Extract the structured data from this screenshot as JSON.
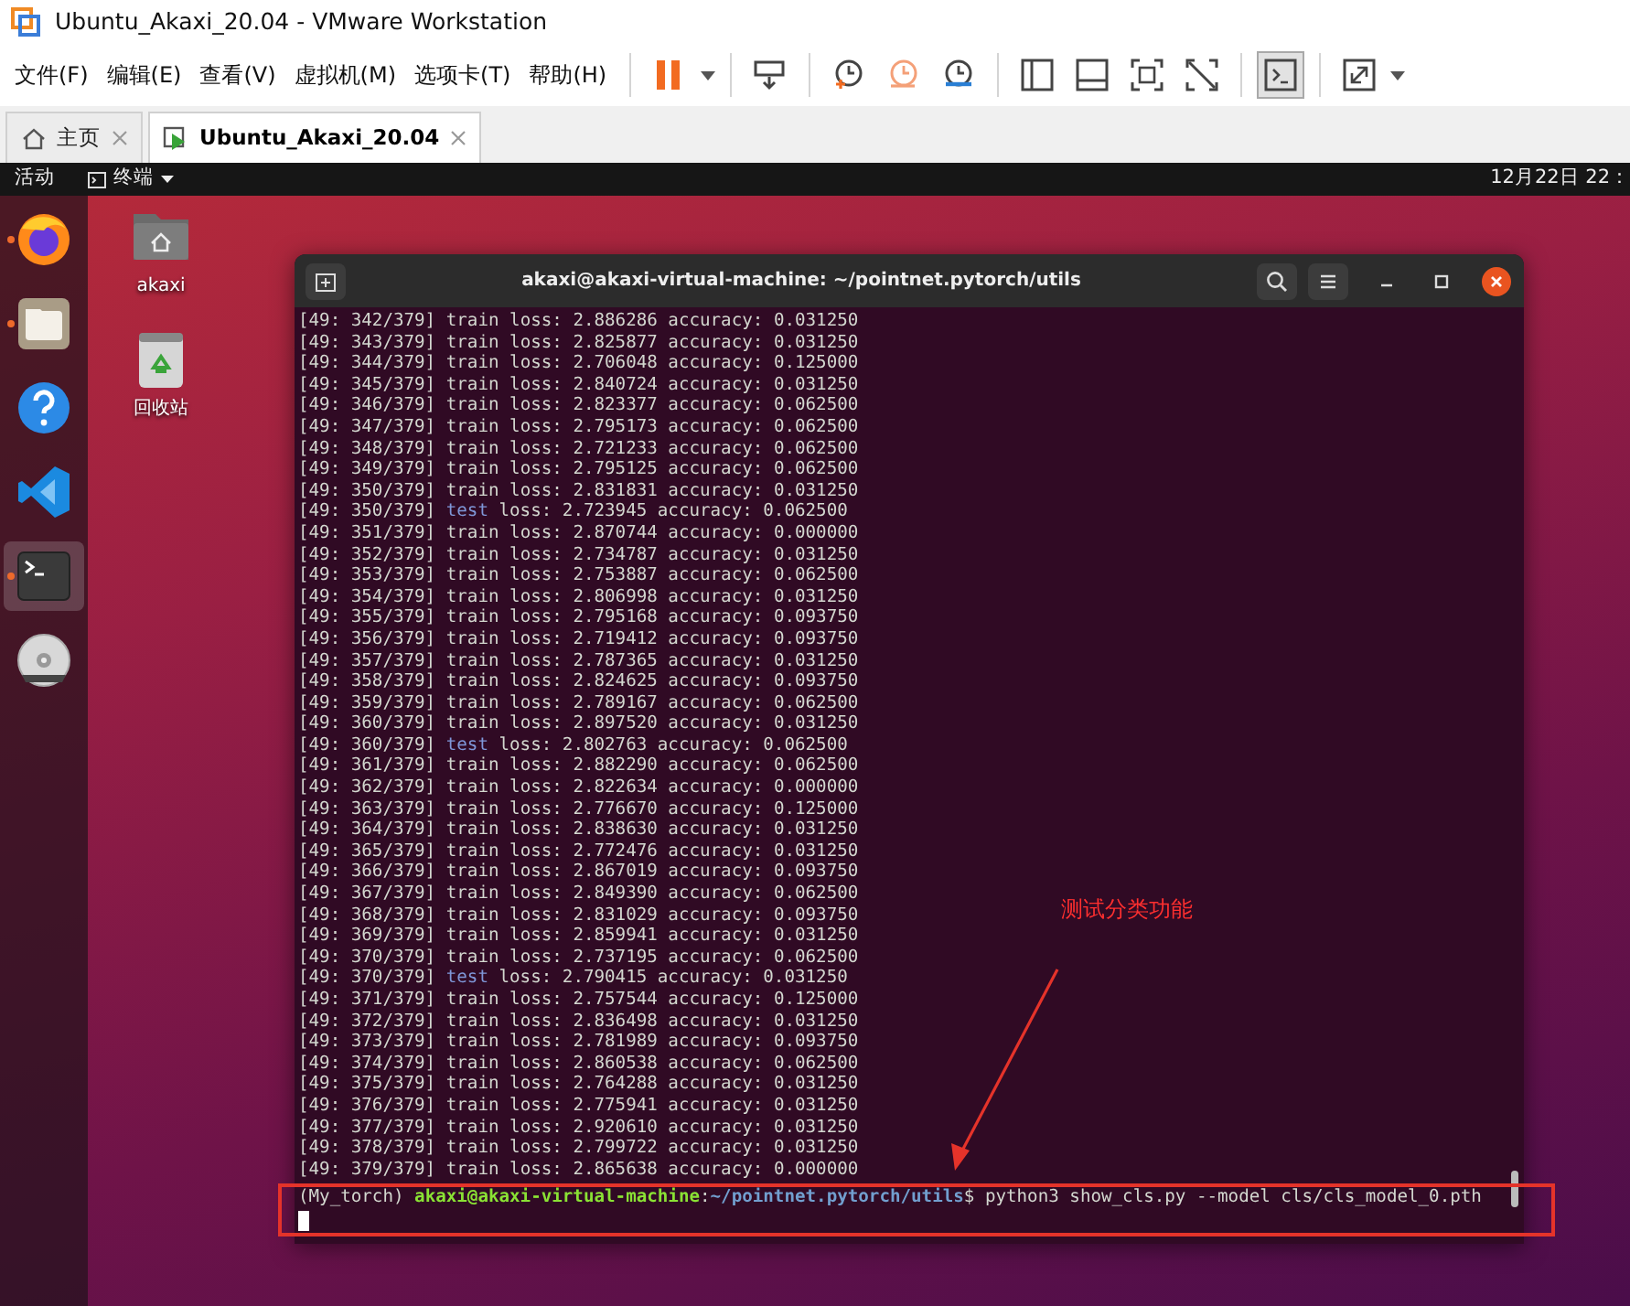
{
  "window": {
    "title": "Ubuntu_Akaxi_20.04 - VMware Workstation"
  },
  "menu": [
    "文件(F)",
    "编辑(E)",
    "查看(V)",
    "虚拟机(M)",
    "选项卡(T)",
    "帮助(H)"
  ],
  "toolbar": [
    [
      {
        "kind": "pause",
        "dropdown": true,
        "selected": false
      }
    ],
    [
      {
        "kind": "send-keys",
        "dropdown": false,
        "selected": false
      }
    ],
    [
      {
        "kind": "snapshot-take",
        "dropdown": false,
        "selected": false
      },
      {
        "kind": "snapshot-revert",
        "dropdown": false,
        "selected": false
      },
      {
        "kind": "snapshot-manager",
        "dropdown": false,
        "selected": false
      }
    ],
    [
      {
        "kind": "library",
        "dropdown": false,
        "selected": false
      },
      {
        "kind": "thumbnail",
        "dropdown": false,
        "selected": false
      },
      {
        "kind": "fullscreen",
        "dropdown": false,
        "selected": false
      },
      {
        "kind": "unity",
        "dropdown": false,
        "selected": false
      }
    ],
    [
      {
        "kind": "console",
        "dropdown": false,
        "selected": true
      }
    ],
    [
      {
        "kind": "stretch",
        "dropdown": true,
        "selected": false
      }
    ]
  ],
  "tabs": [
    {
      "kind": "home",
      "label": "主页",
      "selected": false
    },
    {
      "kind": "vm",
      "label": "Ubuntu_Akaxi_20.04",
      "selected": true
    }
  ],
  "guest_topbar": {
    "activities": "活动",
    "app_menu": "终端",
    "clock": "12月22日 22："
  },
  "dock": [
    {
      "kind": "firefox",
      "running": true,
      "selected": false
    },
    {
      "kind": "files",
      "running": true,
      "selected": false
    },
    {
      "kind": "help",
      "running": false,
      "selected": false
    },
    {
      "kind": "vscode",
      "running": false,
      "selected": false
    },
    {
      "kind": "terminal",
      "running": true,
      "selected": true
    },
    {
      "kind": "dvd",
      "running": false,
      "selected": false
    }
  ],
  "desktop_icons": [
    {
      "kind": "home-folder",
      "label": "akaxi"
    },
    {
      "kind": "trash",
      "label": "回收站"
    }
  ],
  "terminal": {
    "title": "akaxi@akaxi-virtual-machine: ~/pointnet.pytorch/utils",
    "lines": [
      {
        "kind": "train",
        "step": "[49: 342/379]",
        "label": "train",
        "rest": "loss: 2.886286 accuracy: 0.031250"
      },
      {
        "kind": "train",
        "step": "[49: 343/379]",
        "label": "train",
        "rest": "loss: 2.825877 accuracy: 0.031250"
      },
      {
        "kind": "train",
        "step": "[49: 344/379]",
        "label": "train",
        "rest": "loss: 2.706048 accuracy: 0.125000"
      },
      {
        "kind": "train",
        "step": "[49: 345/379]",
        "label": "train",
        "rest": "loss: 2.840724 accuracy: 0.031250"
      },
      {
        "kind": "train",
        "step": "[49: 346/379]",
        "label": "train",
        "rest": "loss: 2.823377 accuracy: 0.062500"
      },
      {
        "kind": "train",
        "step": "[49: 347/379]",
        "label": "train",
        "rest": "loss: 2.795173 accuracy: 0.062500"
      },
      {
        "kind": "train",
        "step": "[49: 348/379]",
        "label": "train",
        "rest": "loss: 2.721233 accuracy: 0.062500"
      },
      {
        "kind": "train",
        "step": "[49: 349/379]",
        "label": "train",
        "rest": "loss: 2.795125 accuracy: 0.062500"
      },
      {
        "kind": "train",
        "step": "[49: 350/379]",
        "label": "train",
        "rest": "loss: 2.831831 accuracy: 0.031250"
      },
      {
        "kind": "test",
        "step": "[49: 350/379]",
        "label": "test",
        "rest": "loss: 2.723945 accuracy: 0.062500"
      },
      {
        "kind": "train",
        "step": "[49: 351/379]",
        "label": "train",
        "rest": "loss: 2.870744 accuracy: 0.000000"
      },
      {
        "kind": "train",
        "step": "[49: 352/379]",
        "label": "train",
        "rest": "loss: 2.734787 accuracy: 0.031250"
      },
      {
        "kind": "train",
        "step": "[49: 353/379]",
        "label": "train",
        "rest": "loss: 2.753887 accuracy: 0.062500"
      },
      {
        "kind": "train",
        "step": "[49: 354/379]",
        "label": "train",
        "rest": "loss: 2.806998 accuracy: 0.031250"
      },
      {
        "kind": "train",
        "step": "[49: 355/379]",
        "label": "train",
        "rest": "loss: 2.795168 accuracy: 0.093750"
      },
      {
        "kind": "train",
        "step": "[49: 356/379]",
        "label": "train",
        "rest": "loss: 2.719412 accuracy: 0.093750"
      },
      {
        "kind": "train",
        "step": "[49: 357/379]",
        "label": "train",
        "rest": "loss: 2.787365 accuracy: 0.031250"
      },
      {
        "kind": "train",
        "step": "[49: 358/379]",
        "label": "train",
        "rest": "loss: 2.824625 accuracy: 0.093750"
      },
      {
        "kind": "train",
        "step": "[49: 359/379]",
        "label": "train",
        "rest": "loss: 2.789167 accuracy: 0.062500"
      },
      {
        "kind": "train",
        "step": "[49: 360/379]",
        "label": "train",
        "rest": "loss: 2.897520 accuracy: 0.031250"
      },
      {
        "kind": "test",
        "step": "[49: 360/379]",
        "label": "test",
        "rest": "loss: 2.802763 accuracy: 0.062500"
      },
      {
        "kind": "train",
        "step": "[49: 361/379]",
        "label": "train",
        "rest": "loss: 2.882290 accuracy: 0.062500"
      },
      {
        "kind": "train",
        "step": "[49: 362/379]",
        "label": "train",
        "rest": "loss: 2.822634 accuracy: 0.000000"
      },
      {
        "kind": "train",
        "step": "[49: 363/379]",
        "label": "train",
        "rest": "loss: 2.776670 accuracy: 0.125000"
      },
      {
        "kind": "train",
        "step": "[49: 364/379]",
        "label": "train",
        "rest": "loss: 2.838630 accuracy: 0.031250"
      },
      {
        "kind": "train",
        "step": "[49: 365/379]",
        "label": "train",
        "rest": "loss: 2.772476 accuracy: 0.031250"
      },
      {
        "kind": "train",
        "step": "[49: 366/379]",
        "label": "train",
        "rest": "loss: 2.867019 accuracy: 0.093750"
      },
      {
        "kind": "train",
        "step": "[49: 367/379]",
        "label": "train",
        "rest": "loss: 2.849390 accuracy: 0.062500"
      },
      {
        "kind": "train",
        "step": "[49: 368/379]",
        "label": "train",
        "rest": "loss: 2.831029 accuracy: 0.093750"
      },
      {
        "kind": "train",
        "step": "[49: 369/379]",
        "label": "train",
        "rest": "loss: 2.859941 accuracy: 0.031250"
      },
      {
        "kind": "train",
        "step": "[49: 370/379]",
        "label": "train",
        "rest": "loss: 2.737195 accuracy: 0.062500"
      },
      {
        "kind": "test",
        "step": "[49: 370/379]",
        "label": "test",
        "rest": "loss: 2.790415 accuracy: 0.031250"
      },
      {
        "kind": "train",
        "step": "[49: 371/379]",
        "label": "train",
        "rest": "loss: 2.757544 accuracy: 0.125000"
      },
      {
        "kind": "train",
        "step": "[49: 372/379]",
        "label": "train",
        "rest": "loss: 2.836498 accuracy: 0.031250"
      },
      {
        "kind": "train",
        "step": "[49: 373/379]",
        "label": "train",
        "rest": "loss: 2.781989 accuracy: 0.093750"
      },
      {
        "kind": "train",
        "step": "[49: 374/379]",
        "label": "train",
        "rest": "loss: 2.860538 accuracy: 0.062500"
      },
      {
        "kind": "train",
        "step": "[49: 375/379]",
        "label": "train",
        "rest": "loss: 2.764288 accuracy: 0.031250"
      },
      {
        "kind": "train",
        "step": "[49: 376/379]",
        "label": "train",
        "rest": "loss: 2.775941 accuracy: 0.031250"
      },
      {
        "kind": "train",
        "step": "[49: 377/379]",
        "label": "train",
        "rest": "loss: 2.920610 accuracy: 0.031250"
      },
      {
        "kind": "train",
        "step": "[49: 378/379]",
        "label": "train",
        "rest": "loss: 2.799722 accuracy: 0.031250"
      },
      {
        "kind": "train",
        "step": "[49: 379/379]",
        "label": "train",
        "rest": "loss: 2.865638 accuracy: 0.000000"
      }
    ],
    "prompt": {
      "env": "(My_torch)",
      "user_host": "akaxi@akaxi-virtual-machine",
      "separator": ":",
      "path": "~/pointnet.pytorch/utils",
      "command": "$ python3 show_cls.py --model cls/cls_model_0.pth"
    }
  },
  "annotation": {
    "text": "测试分类功能"
  }
}
